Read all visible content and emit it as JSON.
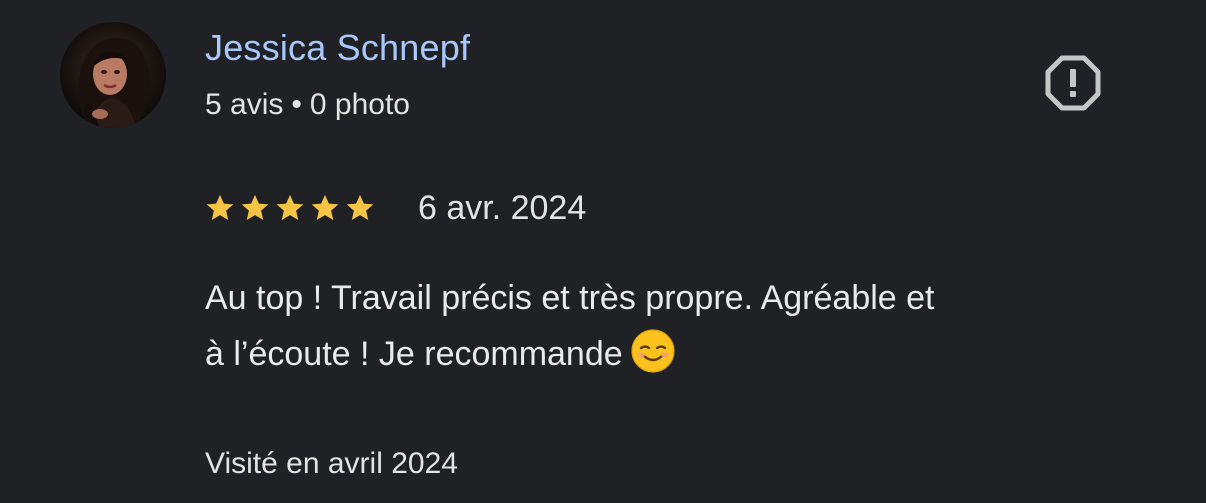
{
  "review": {
    "author_name": "Jessica Schnepf",
    "review_count": "5 avis",
    "separator": "•",
    "photo_count": "0 photo",
    "rating": 5,
    "rating_max": 5,
    "date": "6 avr. 2024",
    "text_line1": "Au top ! Travail précis et très propre. Agréable et",
    "text_line2": "à l’écoute ! Je recommande",
    "emoji": "smiling-face-emoji",
    "visit": "Visité en avril 2024"
  },
  "icons": {
    "report": "report-icon",
    "star": "star-icon"
  },
  "colors": {
    "background": "#202124",
    "name": "#a8c7fa",
    "star": "#f6c445",
    "text": "#e8eaed",
    "icon": "#c4c7c5"
  }
}
